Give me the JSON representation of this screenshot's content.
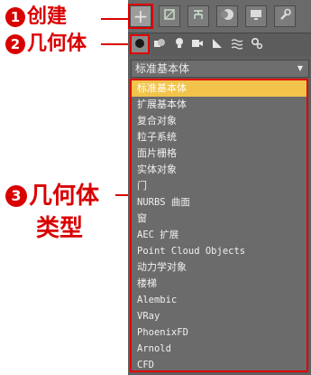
{
  "annotations": {
    "create": {
      "number": "1",
      "text": "创建"
    },
    "geometry": {
      "number": "2",
      "text": "几何体"
    },
    "types": {
      "number": "3",
      "line1": "几何体",
      "line2": "类型"
    }
  },
  "panel": {
    "tabs": [
      {
        "icon": "plus-icon",
        "glyph": "+"
      },
      {
        "icon": "modify-icon",
        "glyph": "⌐"
      },
      {
        "icon": "hierarchy-icon",
        "glyph": "⊤"
      },
      {
        "icon": "motion-icon",
        "glyph": "●"
      },
      {
        "icon": "display-icon",
        "glyph": "▬"
      },
      {
        "icon": "utilities-icon",
        "glyph": "🔧"
      }
    ],
    "subcategories": [
      {
        "icon": "geometry-sphere-icon",
        "glyph": "●"
      },
      {
        "icon": "shapes-icon",
        "glyph": "◆"
      },
      {
        "icon": "lights-icon",
        "glyph": "♦"
      },
      {
        "icon": "cameras-icon",
        "glyph": "■"
      },
      {
        "icon": "helpers-icon",
        "glyph": "◣"
      },
      {
        "icon": "space-warps-icon",
        "glyph": "≋"
      },
      {
        "icon": "systems-icon",
        "glyph": "✿"
      }
    ],
    "dropdown": {
      "value": "标准基本体"
    },
    "list": [
      {
        "label": "标准基本体",
        "selected": true,
        "mono": false
      },
      {
        "label": "扩展基本体",
        "selected": false,
        "mono": false
      },
      {
        "label": "复合对象",
        "selected": false,
        "mono": false
      },
      {
        "label": "粒子系统",
        "selected": false,
        "mono": false
      },
      {
        "label": "面片栅格",
        "selected": false,
        "mono": false
      },
      {
        "label": "实体对象",
        "selected": false,
        "mono": false
      },
      {
        "label": "门",
        "selected": false,
        "mono": false
      },
      {
        "label": "NURBS 曲面",
        "selected": false,
        "mono": true
      },
      {
        "label": "窗",
        "selected": false,
        "mono": false
      },
      {
        "label": "AEC 扩展",
        "selected": false,
        "mono": true
      },
      {
        "label": "Point Cloud Objects",
        "selected": false,
        "mono": true
      },
      {
        "label": "动力学对象",
        "selected": false,
        "mono": false
      },
      {
        "label": "楼梯",
        "selected": false,
        "mono": false
      },
      {
        "label": "Alembic",
        "selected": false,
        "mono": true
      },
      {
        "label": "VRay",
        "selected": false,
        "mono": true
      },
      {
        "label": "PhoenixFD",
        "selected": false,
        "mono": true
      },
      {
        "label": "Arnold",
        "selected": false,
        "mono": true
      },
      {
        "label": "CFD",
        "selected": false,
        "mono": true
      }
    ]
  },
  "colors": {
    "annotation": "#d90000",
    "selection": "#f2c44b",
    "panel": "#5f5f5f"
  }
}
